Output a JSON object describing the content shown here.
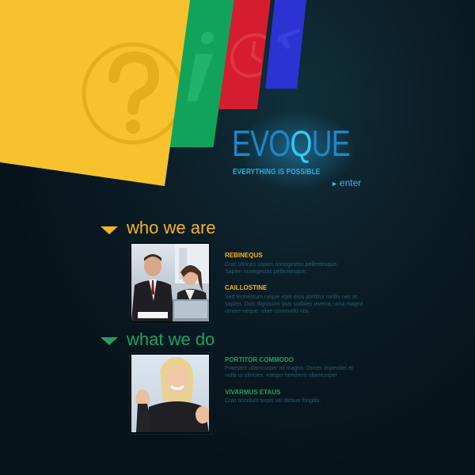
{
  "brand": {
    "logo_pre": "EVO",
    "logo_q": "Q",
    "logo_post": "UE",
    "tagline": "EVERYTHING IS POSSIBLE",
    "enter": "enter"
  },
  "colors": {
    "yellow": "#f7c22d",
    "green": "#12a35a",
    "red": "#d51d2f",
    "blue": "#2c33d2",
    "accent": "#35b7ef"
  },
  "sections": [
    {
      "title": "who we are",
      "color": "#f5b324",
      "items": [
        {
          "heading": "REBINEQUS",
          "text": "Cras ultrices sapien nonegestas pellentesque.",
          "text2": "Sapien nonegestas pellentesque."
        },
        {
          "heading": "CAILLOSTINE",
          "text": "Sed fermentum neque eget eros porttitor mollis nec at",
          "text2": "sapien. Duis dignissim quis sodales viverra, urna magna",
          "text3": "ornare neque, vitae commodo nisi."
        }
      ]
    },
    {
      "title": "what we do",
      "color": "#1ea163",
      "items": [
        {
          "heading": "PORTITOR COMMODO",
          "text": "Praesent ullamcorper mi magna. Donec imperdiet et",
          "text2": "nulla ut ultricies. Integer hendrerit ullamcorper"
        },
        {
          "heading": "VIVARMUS ETAUS",
          "text": "Cras tincidunt turpis vel dictum fringilla."
        }
      ]
    }
  ],
  "icons": [
    "question-icon",
    "info-icon",
    "clock-icon",
    "airplane-icon",
    "enter-arrow-icon",
    "triangle-down-icon"
  ]
}
